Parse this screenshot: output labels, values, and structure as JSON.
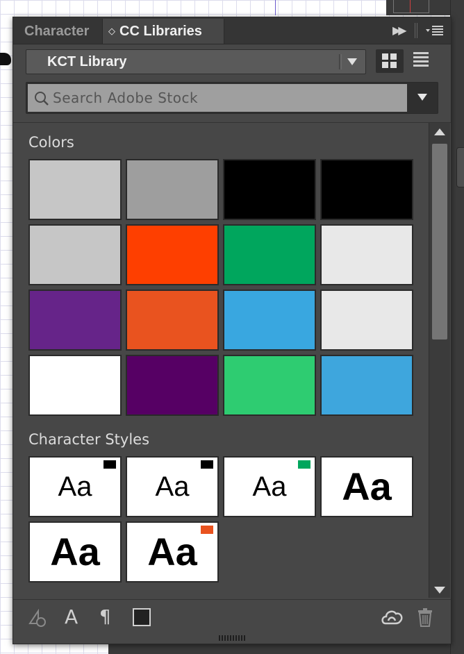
{
  "panel": {
    "tabs": [
      {
        "label": "Character",
        "active": false
      },
      {
        "label": "CC Libraries",
        "active": true
      }
    ],
    "tab_arrows_glyph": "◇",
    "collapse_glyph": "▶▶"
  },
  "library": {
    "selected": "KCT Library"
  },
  "search": {
    "placeholder": "Search Adobe Stock",
    "value": ""
  },
  "sections": {
    "colors_title": "Colors",
    "character_styles_title": "Character Styles"
  },
  "colors": [
    "#c6c6c6",
    "#9e9e9e",
    "#000000",
    "#000000",
    "#c6c6c6",
    "#fe3f00",
    "#00a65d",
    "#e8e8e8",
    "#662489",
    "#e9531f",
    "#39a7e0",
    "#e8e8e8",
    "#ffffff",
    "#560064",
    "#2ecc71",
    "#3ea6dd"
  ],
  "character_styles": [
    {
      "sample": "Aa",
      "weight": "light",
      "chip": "#000000"
    },
    {
      "sample": "Aa",
      "weight": "light",
      "chip": "#000000"
    },
    {
      "sample": "Aa",
      "weight": "light",
      "chip": "#00a65d"
    },
    {
      "sample": "Aa",
      "weight": "bold",
      "chip": null
    },
    {
      "sample": "Aa",
      "weight": "bold",
      "chip": null
    },
    {
      "sample": "Aa",
      "weight": "bold",
      "chip": "#e9531f"
    }
  ],
  "toolbar": {
    "text_glyph": "A",
    "paragraph_glyph": "¶",
    "icons": [
      "add-graphic-icon",
      "add-character-style-icon",
      "add-paragraph-style-icon",
      "add-color-icon",
      "creative-cloud-sync-icon",
      "trash-icon"
    ]
  }
}
